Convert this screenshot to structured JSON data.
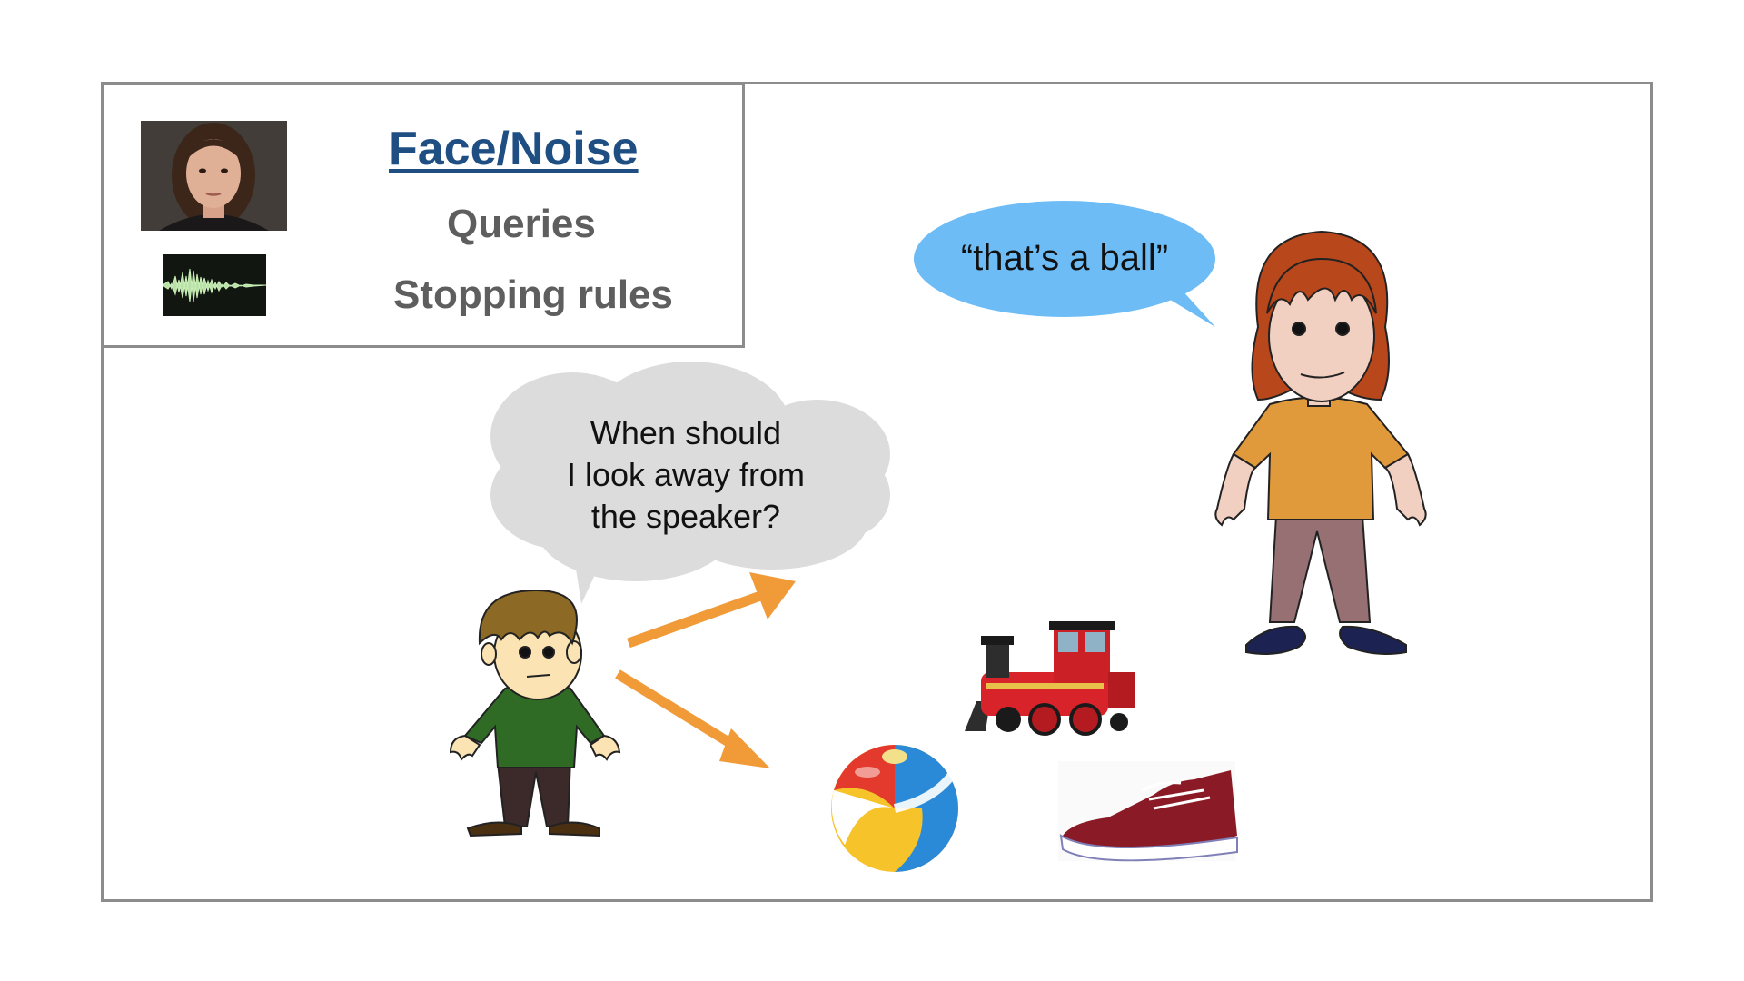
{
  "legend": {
    "title": "Face/Noise",
    "items": [
      "Queries",
      "Stopping rules"
    ],
    "face_thumbnail": "face-photo",
    "noise_thumbnail": "waveform-icon"
  },
  "speech_bubble": {
    "text": "“that’s a ball”",
    "color": "#6dbcf6"
  },
  "thought_bubble": {
    "lines": [
      "When should",
      "I look away from",
      "the speaker?"
    ],
    "color": "#dcdcdc"
  },
  "colors": {
    "arrow": "#f09a38",
    "title": "#1f4e82",
    "frame": "#8c8c8c"
  }
}
